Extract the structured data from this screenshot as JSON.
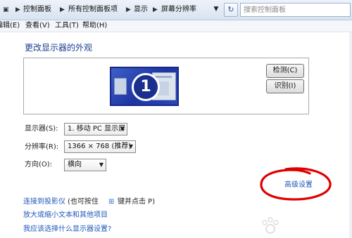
{
  "address_bar": {
    "breadcrumbs": [
      "控制面板",
      "所有控制面板项",
      "显示",
      "屏幕分辨率"
    ],
    "search_placeholder": "搜索控制面板"
  },
  "menu": {
    "items": [
      "编辑(E)",
      "查看(V)",
      "工具(T)",
      "帮助(H)"
    ]
  },
  "page": {
    "title": "更改显示器的外观",
    "monitor_number": "1",
    "detect_button": "检测(C)",
    "identify_button": "识别(I)",
    "display_label": "显示器(S):",
    "display_value": "1. 移动 PC 显示屏",
    "resolution_label": "分辨率(R):",
    "resolution_value": "1366 × 768 (推荐)",
    "orientation_label": "方向(O):",
    "orientation_value": "横向",
    "advanced_link": "高级设置"
  },
  "links": {
    "projector_prefix": "连接到投影仪",
    "projector_suffix": "(也可按住",
    "projector_key_suffix": "键并点击 P)",
    "text_size": "放大或缩小文本和其他项目",
    "which_settings": "我应该选择什么显示器设置?"
  },
  "colors": {
    "link": "#1f57b8",
    "title": "#1a3e8f",
    "annotation_circle": "#e00000"
  }
}
